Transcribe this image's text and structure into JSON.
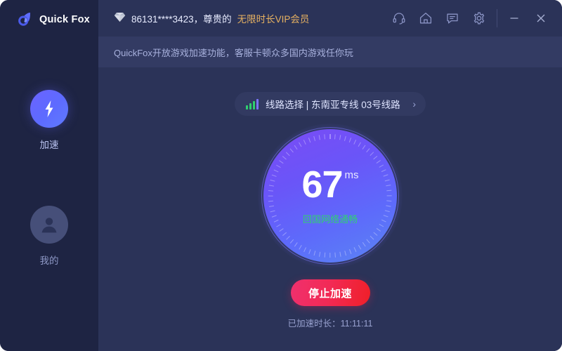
{
  "app": {
    "name": "QuickFox",
    "logo_text": "Quick Fox",
    "logo_icon": "fox-droplet-logo-icon"
  },
  "sidebar": {
    "items": [
      {
        "label": "加速",
        "icon": "lightning-bolt-icon",
        "active": true
      },
      {
        "label": "我的",
        "icon": "user-avatar-icon",
        "active": false
      }
    ]
  },
  "titlebar": {
    "vip_badge_icon": "diamond-icon",
    "account_id": "86131****3423，尊贵的",
    "vip_level": "无限时长VIP会员",
    "icons": [
      {
        "name": "customer-service-icon",
        "label": "客服"
      },
      {
        "name": "home-icon",
        "label": "首页"
      },
      {
        "name": "message-icon",
        "label": "消息"
      },
      {
        "name": "settings-gear-icon",
        "label": "设置"
      }
    ],
    "window_controls": [
      {
        "name": "minimize-button",
        "glyph": "—"
      },
      {
        "name": "close-button",
        "glyph": "✕"
      }
    ]
  },
  "notice": {
    "text": "QuickFox开放游戏加速功能，客服卡顿众多国内游戏任你玩"
  },
  "line_select": {
    "signal_icon": "signal-bars-icon",
    "text": "线路选择 | 东南亚专线 03号线路",
    "arrow": "›"
  },
  "gauge": {
    "ping_value": "67",
    "ping_unit": "ms",
    "status_text": "回国网络通畅",
    "status_color": "#2fd36f"
  },
  "action": {
    "stop_label": "停止加速",
    "duration_text": "已加速时长：11:11:11"
  },
  "colors": {
    "sidebar_bg": "#1e2443",
    "panel_bg": "#2b3358",
    "notice_bg": "#333b63",
    "accent_blue": "#6a5ffb",
    "vip_gold": "#e8b261",
    "stop_red": "#f2295a",
    "status_green": "#2fd36f"
  }
}
